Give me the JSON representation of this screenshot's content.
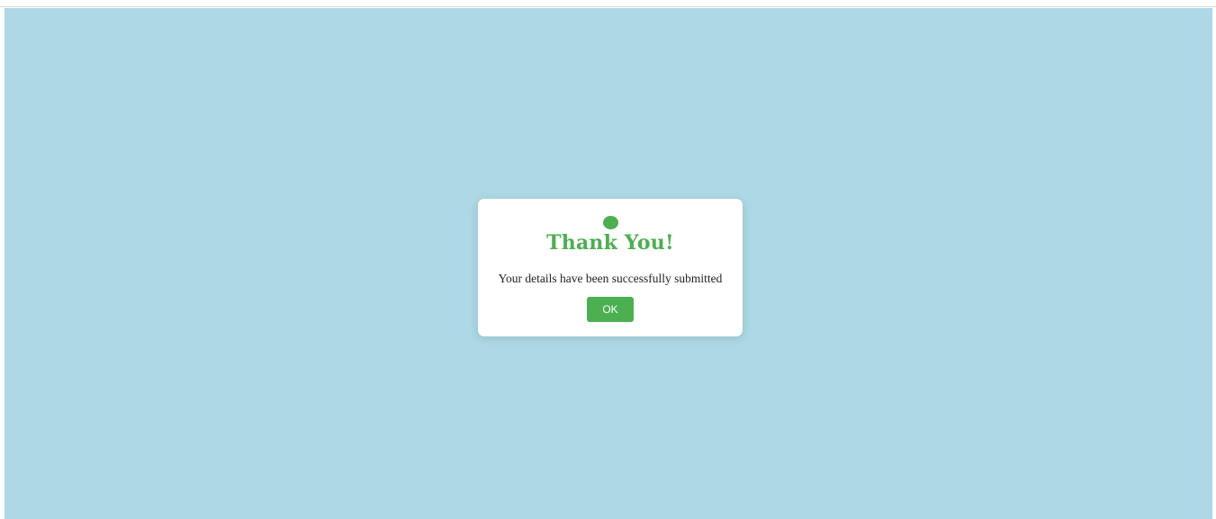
{
  "dialog": {
    "title": "Thank You!",
    "message": "Your details have been successfully submitted",
    "ok_label": "OK",
    "icon": "success-dot-icon"
  },
  "colors": {
    "backdrop": "#add8e5",
    "accent": "#4caf50",
    "dialog_background": "#ffffff"
  }
}
